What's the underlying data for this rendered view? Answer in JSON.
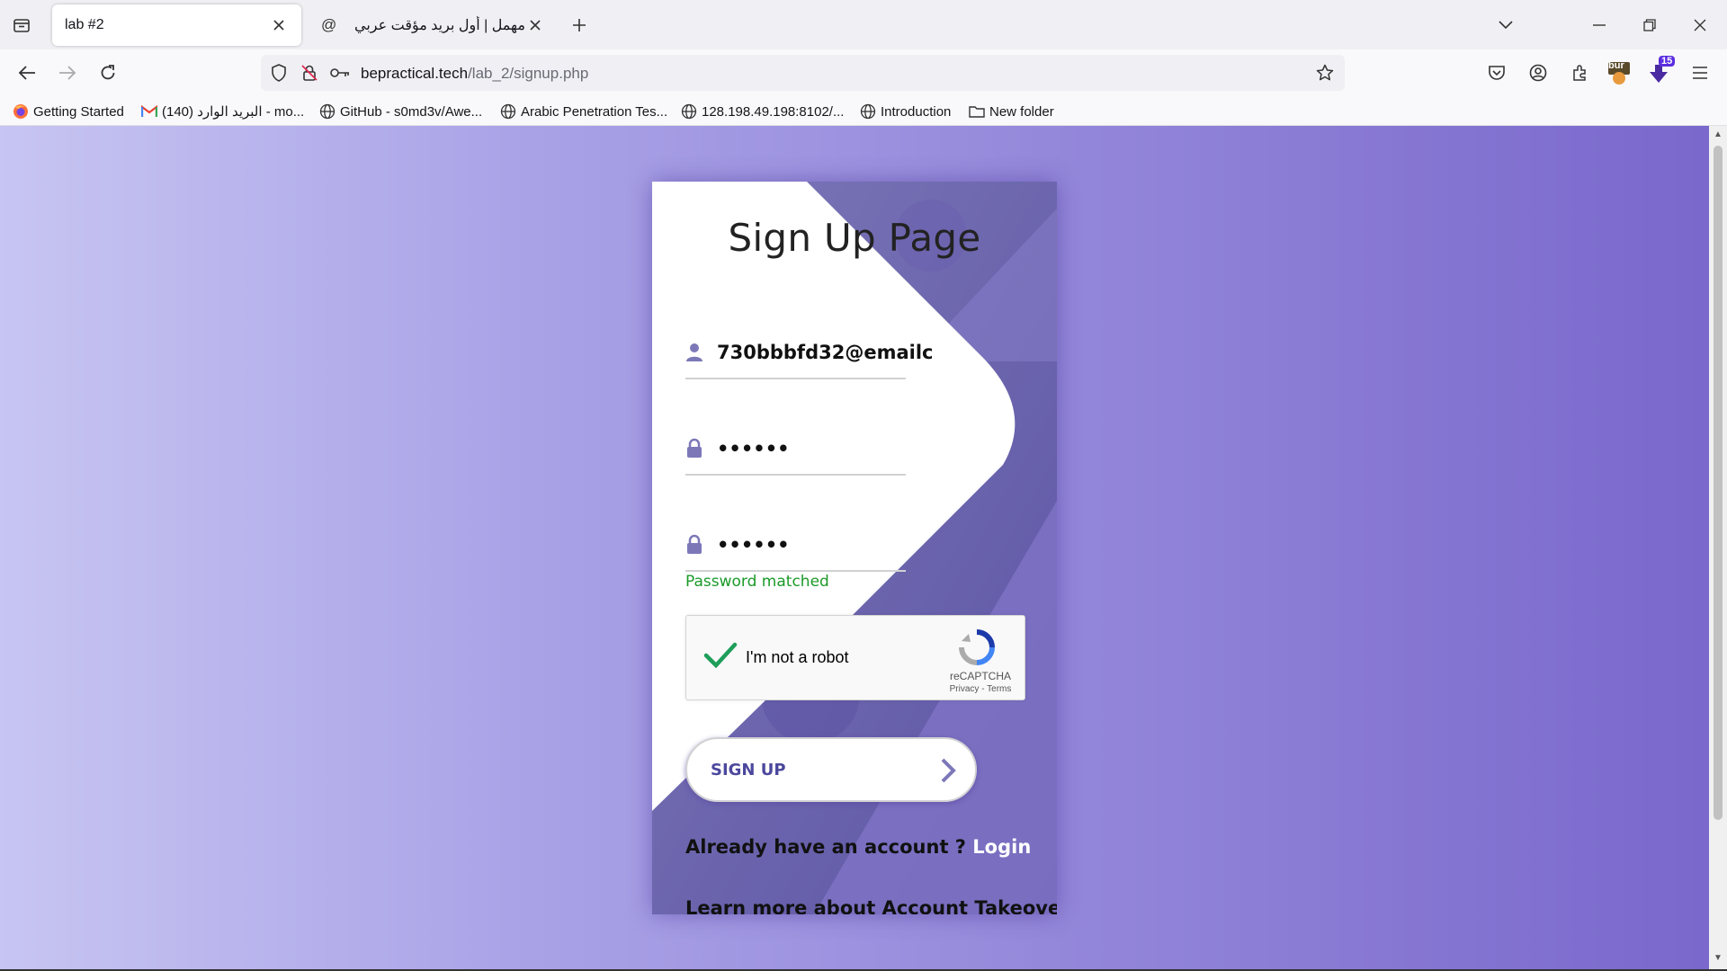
{
  "browser": {
    "tabs": [
      {
        "title": "lab #2",
        "active": true
      },
      {
        "title": "مهمل | أول بريد مؤقت عربي",
        "favicon": "@",
        "active": false
      }
    ],
    "url": {
      "host": "bepractical.tech",
      "path": "/lab_2/signup.php"
    },
    "extension_badge": "15",
    "bur_badge": "bur"
  },
  "bookmarks": [
    {
      "label": "Getting Started",
      "icon": "firefox-icon"
    },
    {
      "label": "البريد الوارد (140) - mo...",
      "icon": "gmail-icon"
    },
    {
      "label": "GitHub - s0md3v/Awe...",
      "icon": "globe-icon"
    },
    {
      "label": "Arabic Penetration Tes...",
      "icon": "globe-icon"
    },
    {
      "label": "128.198.49.198:8102/...",
      "icon": "globe-icon"
    },
    {
      "label": "Introduction",
      "icon": "globe-icon"
    },
    {
      "label": "New folder",
      "icon": "folder-icon"
    }
  ],
  "page": {
    "title": "Sign Up Page",
    "email_value": "730bbbfd32@emailc",
    "password_value": "••••••",
    "confirm_password_value": "••••••",
    "match_message": "Password matched",
    "captcha": {
      "label": "I'm not a robot",
      "brand": "reCAPTCHA",
      "links": "Privacy - Terms"
    },
    "signup_label": "SIGN UP",
    "have_account_text": "Already have an account ?",
    "login_link": "Login",
    "learn_more": "Learn more about Account Takeover"
  },
  "colors": {
    "accent": "#4c489d",
    "gradient_left": "#c7c5f2",
    "gradient_right": "#7a68cc",
    "match": "#1b9a28"
  }
}
